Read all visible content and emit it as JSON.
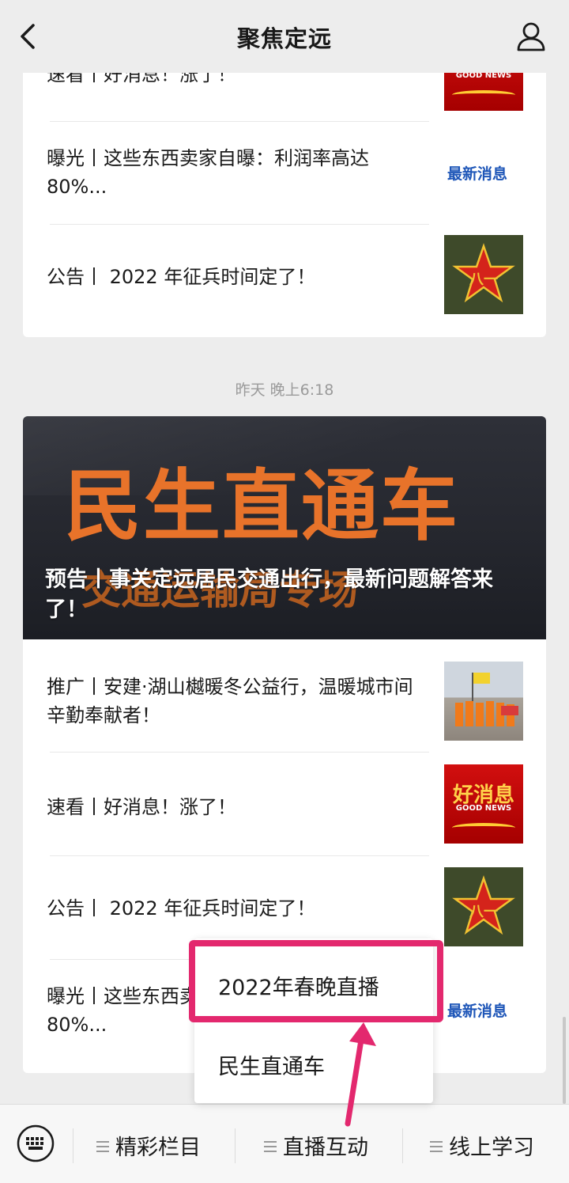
{
  "nav": {
    "title": "聚焦定远"
  },
  "top_card": {
    "partial_title": "速看丨好消息！涨了！",
    "items": [
      {
        "title": "曝光丨这些东西卖家自曝：利润率高达80%...",
        "thumb_text": "最新消息"
      },
      {
        "title": "公告丨 2022 年征兵时间定了！"
      }
    ]
  },
  "timestamp": "昨天 晚上6:18",
  "feature_card": {
    "banner": {
      "big_text": "民生直通车",
      "sub_text": "交通运输局专场",
      "title": "预告丨事关定远居民交通出行，最新问题解答来了！"
    },
    "items": [
      {
        "title": "推广丨安建·湖山樾暖冬公益行，温暖城市间辛勤奉献者！"
      },
      {
        "title": "速看丨好消息！涨了！",
        "thumb_big": "好消息",
        "thumb_small": "GOOD NEWS"
      },
      {
        "title": "公告丨 2022 年征兵时间定了！"
      },
      {
        "title": "曝光丨这些东西卖家自曝：利润率高达80%...",
        "thumb_text": "最新消息"
      }
    ]
  },
  "popup_menu": {
    "items": [
      "2022年春晚直播",
      "民生直通车"
    ]
  },
  "bottom_bar": {
    "tabs": [
      "精彩栏目",
      "直播互动",
      "线上学习"
    ]
  },
  "colors": {
    "highlight": "#e3286e",
    "banner_text": "#e8732a",
    "latest_news_blue": "#1e56b8"
  }
}
